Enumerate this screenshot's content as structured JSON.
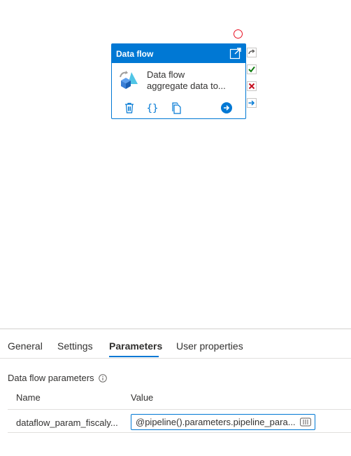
{
  "activity": {
    "header_title": "Data flow",
    "name_line1": "Data flow",
    "name_line2": "aggregate data to..."
  },
  "tabs": [
    {
      "label": "General"
    },
    {
      "label": "Settings"
    },
    {
      "label": "Parameters",
      "active": true
    },
    {
      "label": "User properties"
    }
  ],
  "parameters_section": {
    "title": "Data flow parameters",
    "columns": {
      "name": "Name",
      "value": "Value"
    },
    "rows": [
      {
        "name": "dataflow_param_fiscaly...",
        "value": "@pipeline().parameters.pipeline_para..."
      }
    ]
  },
  "colors": {
    "accent": "#0078d4",
    "success": "#107c10",
    "failure": "#c50f1f",
    "error_circle": "#e81123"
  }
}
